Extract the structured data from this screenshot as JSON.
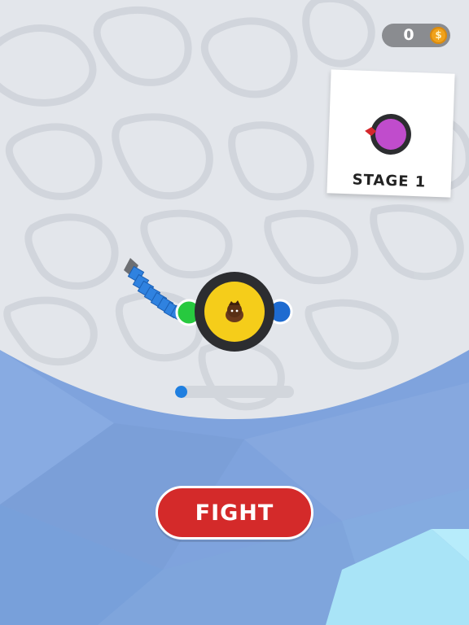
{
  "hud": {
    "coins": "0",
    "coin_icon": "dollar-coin-icon",
    "coin_symbol": "$"
  },
  "stage_card": {
    "label": "STAGE 1",
    "preview_icon": "purple-enemy-disc-icon"
  },
  "player": {
    "icon": "yellow-spinning-disc-with-hero",
    "weapon_icon": "blue-segmented-chain-flail-icon",
    "colors": {
      "disc": "#f5cd1a",
      "rim": "#2c2d30",
      "chain": "#2f82e0",
      "green_marker": "#27c93f",
      "blue_marker": "#1e6bd0"
    }
  },
  "progress": {
    "value": 0.05,
    "color": "#1f7fe0"
  },
  "actions": {
    "fight_label": "FIGHT",
    "fight_color": "#d42a2a"
  },
  "colors": {
    "arena": "#e3e6eb",
    "water": "#7fa3dd"
  }
}
